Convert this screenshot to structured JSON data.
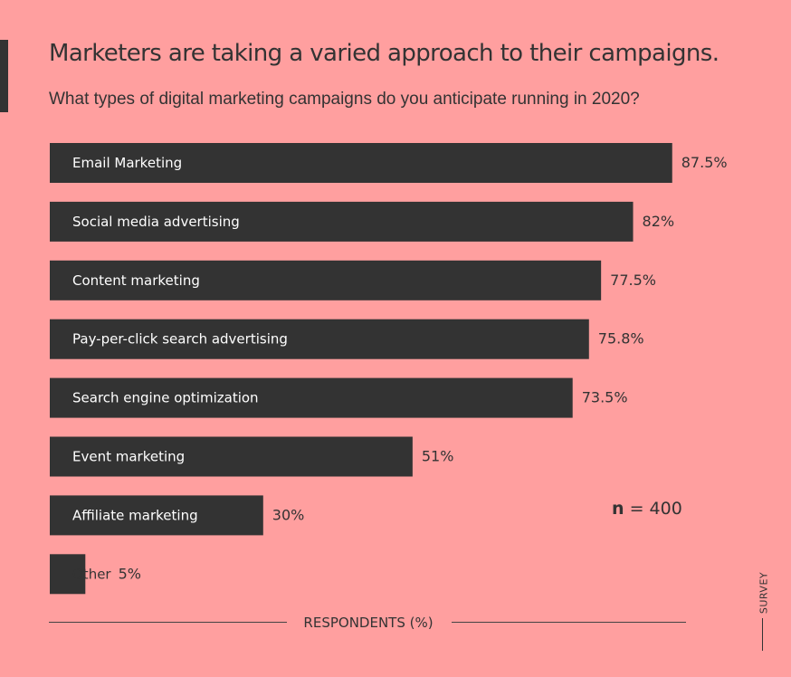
{
  "header": {
    "title": "Marketers are taking a varied approach to their campaigns.",
    "subtitle": "What types of digital marketing campaigns do you anticipate running in 2020?"
  },
  "sample_size": {
    "symbol": "n",
    "equals": " = 400"
  },
  "side_tag": "SURVEY",
  "colors": {
    "background": "#ff9f9f",
    "bar": "#333333",
    "bar_label": "#ffffff"
  },
  "chart_data": {
    "type": "bar",
    "orientation": "horizontal",
    "categories": [
      "Email Marketing",
      "Social media advertising",
      "Content marketing",
      "Pay-per-click search advertising",
      "Search engine optimization",
      "Event marketing",
      "Affiliate marketing",
      "Other"
    ],
    "values": [
      87.5,
      82,
      77.5,
      75.8,
      73.5,
      51,
      30,
      5
    ],
    "value_labels": [
      "87.5%",
      "82%",
      "77.5%",
      "75.8%",
      "73.5%",
      "51%",
      "30%",
      "5%"
    ],
    "title": "Marketers are taking a varied approach to their campaigns.",
    "xlabel": "RESPONDENTS (%)",
    "ylabel": "",
    "xlim": [
      0,
      100
    ],
    "grid": false,
    "legend": "none"
  }
}
